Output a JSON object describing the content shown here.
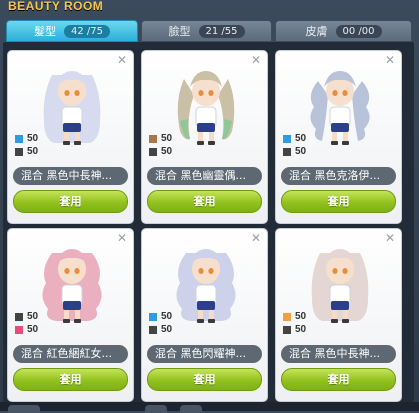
{
  "window": {
    "title": "BEAUTY ROOM"
  },
  "tabs": [
    {
      "label": "髮型",
      "count": "42 /75",
      "active": true
    },
    {
      "label": "臉型",
      "count": "21 /55",
      "active": false
    },
    {
      "label": "皮膚",
      "count": "00 /00",
      "active": false
    }
  ],
  "cards": [
    {
      "name": "混合  黑色中長神...",
      "colors": [
        {
          "value": "50",
          "color": "#2f9be0"
        },
        {
          "value": "50",
          "color": "#444444"
        }
      ],
      "hair_color": "#d7dbef",
      "hair_style": "long-straight",
      "apply_label": "套用"
    },
    {
      "name": "混合  黑色幽靈偶...",
      "colors": [
        {
          "value": "50",
          "color": "#a9764e"
        },
        {
          "value": "50",
          "color": "#444444"
        }
      ],
      "hair_color": "#c9c0a6",
      "hair_tip_color": "#8fc79a",
      "hair_style": "twin-tails",
      "apply_label": "套用"
    },
    {
      "name": "混合  黑色克洛伊...",
      "colors": [
        {
          "value": "50",
          "color": "#2f9be0"
        },
        {
          "value": "50",
          "color": "#444444"
        }
      ],
      "hair_color": "#b8c2d9",
      "hair_style": "wavy-pigtails",
      "apply_label": "套用"
    },
    {
      "name": "混合  紅色綑紅女...",
      "colors": [
        {
          "value": "50",
          "color": "#444444"
        },
        {
          "value": "50",
          "color": "#e0507a"
        }
      ],
      "hair_color": "#eab0c0",
      "hair_style": "long-wavy",
      "apply_label": "套用"
    },
    {
      "name": "混合  黑色閃耀神...",
      "colors": [
        {
          "value": "50",
          "color": "#2f9be0"
        },
        {
          "value": "50",
          "color": "#444444"
        }
      ],
      "hair_color": "#cdd2ea",
      "hair_style": "long-wavy",
      "apply_label": "套用"
    },
    {
      "name": "混合  黑色中長神...",
      "colors": [
        {
          "value": "50",
          "color": "#f0a040"
        },
        {
          "value": "50",
          "color": "#444444"
        }
      ],
      "hair_color": "#e4d6d2",
      "hair_style": "long-straight",
      "apply_label": "套用"
    }
  ]
}
